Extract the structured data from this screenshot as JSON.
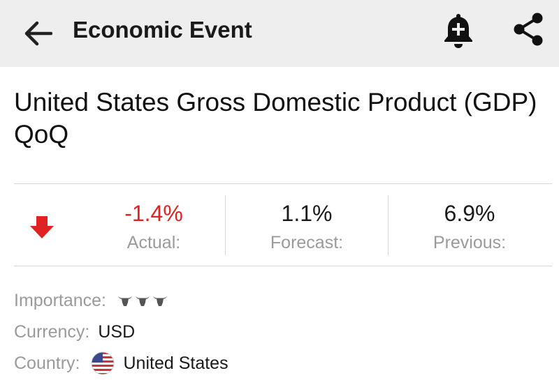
{
  "header": {
    "title": "Economic Event",
    "back_icon": "arrow-left-icon",
    "alert_icon": "bell-add-icon",
    "share_icon": "share-icon"
  },
  "event": {
    "title": "United States Gross Domestic Product (GDP) QoQ",
    "direction_icon": "arrow-down-icon",
    "actual": {
      "value": "-1.4%",
      "label": "Actual:"
    },
    "forecast": {
      "value": "1.1%",
      "label": "Forecast:"
    },
    "previous": {
      "value": "6.9%",
      "label": "Previous:"
    }
  },
  "details": {
    "importance_label": "Importance:",
    "importance_level": 3,
    "importance_icon": "bull-icon",
    "currency_label": "Currency:",
    "currency_value": "USD",
    "country_label": "Country:",
    "country_value": "United States",
    "country_flag_icon": "us-flag-icon"
  },
  "colors": {
    "negative": "#e02222",
    "muted": "#9a9a9a",
    "appbar": "#eeeeee"
  }
}
